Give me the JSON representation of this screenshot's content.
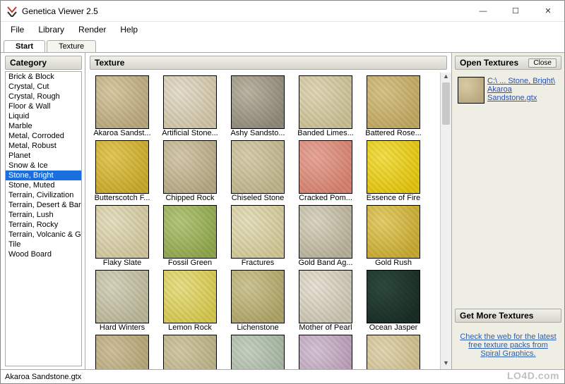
{
  "app": {
    "title": "Genetica Viewer 2.5",
    "icon_color_top": "#c23a2d",
    "icon_color_bot": "#2b2b2b"
  },
  "window_controls": {
    "min": "—",
    "max": "☐",
    "close": "✕"
  },
  "menu": {
    "items": [
      "File",
      "Library",
      "Render",
      "Help"
    ]
  },
  "tabs": {
    "items": [
      "Start",
      "Texture"
    ],
    "active_index": 0
  },
  "category": {
    "header": "Category",
    "selected_index": 10,
    "items": [
      "Brick & Block",
      "Crystal, Cut",
      "Crystal, Rough",
      "Floor & Wall",
      "Liquid",
      "Marble",
      "Metal, Corroded",
      "Metal, Robust",
      "Planet",
      "Snow & Ice",
      "Stone, Bright",
      "Stone, Muted",
      "Terrain, Civilization",
      "Terrain, Desert & Barre",
      "Terrain, Lush",
      "Terrain, Rocky",
      "Terrain, Volcanic & Ga",
      "Tile",
      "Wood Board"
    ]
  },
  "texture": {
    "header": "Texture",
    "items": [
      {
        "label": "Akaroa Sandst...",
        "c1": "#d8cba3",
        "c2": "#b9a77d"
      },
      {
        "label": "Artificial Stone...",
        "c1": "#e6dfcf",
        "c2": "#cfc4a6"
      },
      {
        "label": "Ashy Sandsto...",
        "c1": "#bdb7a5",
        "c2": "#8f8a78"
      },
      {
        "label": "Banded Limes...",
        "c1": "#e0d8b8",
        "c2": "#c9bf95"
      },
      {
        "label": "Battered Rose...",
        "c1": "#d9c38a",
        "c2": "#bfa862"
      },
      {
        "label": "Butterscotch F...",
        "c1": "#e4c95a",
        "c2": "#c8a92d"
      },
      {
        "label": "Chipped Rock",
        "c1": "#d7cbae",
        "c2": "#b5a884"
      },
      {
        "label": "Chiseled Stone",
        "c1": "#d8cfae",
        "c2": "#beb48c"
      },
      {
        "label": "Cracked Pom...",
        "c1": "#e8a99a",
        "c2": "#d6826f"
      },
      {
        "label": "Essence of Fire",
        "c1": "#f2e14a",
        "c2": "#e3c412"
      },
      {
        "label": "Flaky Slate",
        "c1": "#e7e0c1",
        "c2": "#cfc69e"
      },
      {
        "label": "Fossil Green",
        "c1": "#b7c77d",
        "c2": "#8fa74e"
      },
      {
        "label": "Fractures",
        "c1": "#e7e0c0",
        "c2": "#d0c796"
      },
      {
        "label": "Gold Band Ag...",
        "c1": "#dcd7c3",
        "c2": "#b7b09a"
      },
      {
        "label": "Gold Rush",
        "c1": "#e5cf6c",
        "c2": "#c7a933"
      },
      {
        "label": "Hard Winters",
        "c1": "#d7d4be",
        "c2": "#b9b698"
      },
      {
        "label": "Lemon Rock",
        "c1": "#e8e089",
        "c2": "#d4c750"
      },
      {
        "label": "Lichenstone",
        "c1": "#cfc796",
        "c2": "#aea468"
      },
      {
        "label": "Mother of Pearl",
        "c1": "#e7e2d4",
        "c2": "#c9c3b0"
      },
      {
        "label": "Ocean Jasper",
        "c1": "#2f4a3d",
        "c2": "#1a2e25"
      },
      {
        "label": "",
        "c1": "#cfc29c",
        "c2": "#b3a374"
      },
      {
        "label": "",
        "c1": "#d3cba8",
        "c2": "#b7ae82"
      },
      {
        "label": "",
        "c1": "#c7d2c4",
        "c2": "#a3b39e"
      },
      {
        "label": "",
        "c1": "#d6c6d6",
        "c2": "#b89ab4"
      },
      {
        "label": "",
        "c1": "#e3d6b4",
        "c2": "#cbbb88"
      }
    ]
  },
  "sidebar": {
    "open_header": "Open Textures",
    "close_label": "Close",
    "open_items": [
      {
        "line1": "C:\\ ... Stone, Bright\\",
        "line2": "Akaroa",
        "line3": "Sandstone.gtx",
        "c1": "#d8cba3",
        "c2": "#b9a77d"
      }
    ],
    "more_header": "Get More Textures",
    "more_link": "Check the web for the latest free texture packs from Spiral Graphics."
  },
  "status": {
    "text": "Akaroa Sandstone.gtx"
  },
  "watermark": "LO4D.com"
}
